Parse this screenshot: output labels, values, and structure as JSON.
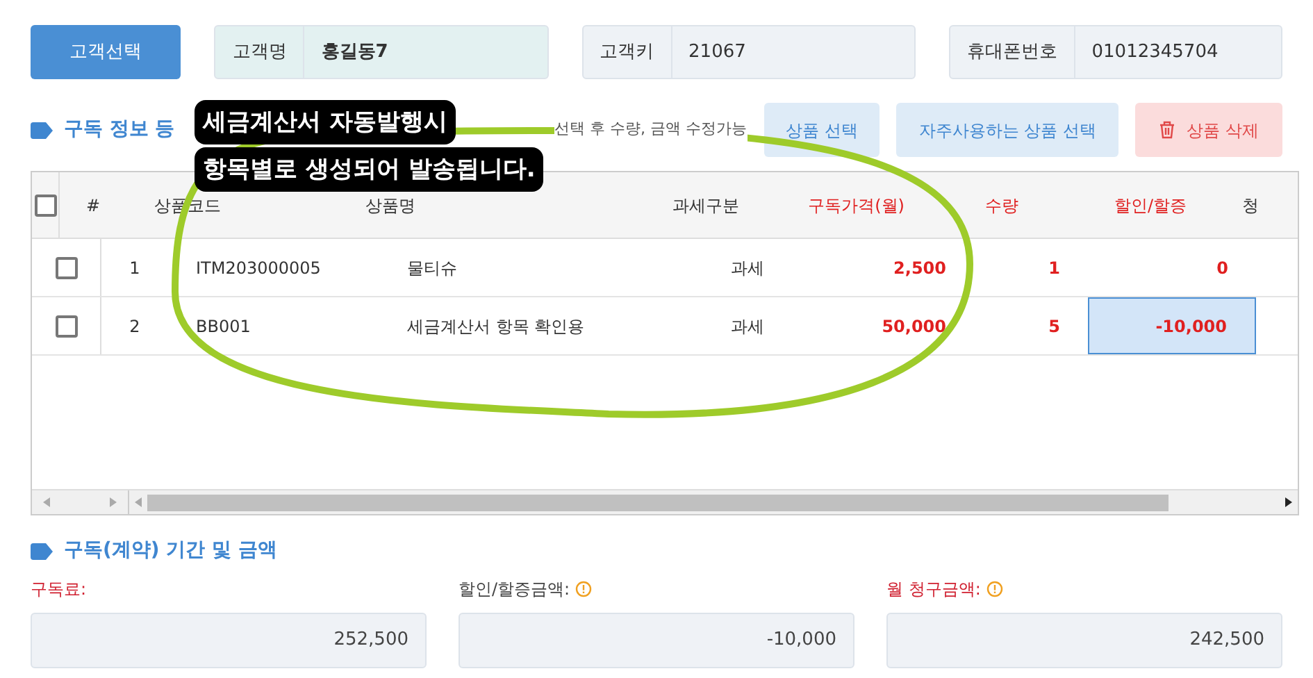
{
  "customer_button": "고객선택",
  "customer_fields": [
    {
      "label": "고객명",
      "value": "홍길동7",
      "highlight": true
    },
    {
      "label": "고객키",
      "value": "21067",
      "highlight": false
    },
    {
      "label": "휴대폰번호",
      "value": "01012345704",
      "highlight": false
    }
  ],
  "subscription_section": {
    "title": "구독 정보 등",
    "hint": "선택 후 수량, 금액 수정가능",
    "buttons": [
      {
        "label": "상품 선택",
        "kind": "normal"
      },
      {
        "label": "자주사용하는 상품 선택",
        "kind": "normal"
      },
      {
        "label": "상품 삭제",
        "kind": "danger"
      }
    ]
  },
  "annotation": {
    "lines": [
      "세금계산서 자동발행시",
      "항목별로 생성되어 발송됩니다."
    ]
  },
  "table": {
    "header_checkbox": {
      "checked": false
    },
    "columns": [
      {
        "label": "#",
        "required": false
      },
      {
        "label": "상품코드",
        "required": false
      },
      {
        "label": "상품명",
        "required": false
      },
      {
        "label": "과세구분",
        "required": false
      },
      {
        "label": "구독가격(월)",
        "required": true
      },
      {
        "label": "수량",
        "required": true
      },
      {
        "label": "할인/할증",
        "required": true
      },
      {
        "label": "청",
        "required": false
      }
    ],
    "rows": [
      {
        "checked": false,
        "cells": [
          {
            "text": "1",
            "selected": false
          },
          {
            "text": "ITM203000005",
            "selected": false
          },
          {
            "text": "물티슈",
            "selected": false
          },
          {
            "text": "과세",
            "selected": false
          },
          {
            "text": "2,500",
            "selected": false
          },
          {
            "text": "1",
            "selected": false
          },
          {
            "text": "0",
            "selected": false
          }
        ]
      },
      {
        "checked": false,
        "cells": [
          {
            "text": "2",
            "selected": false
          },
          {
            "text": "BB001",
            "selected": false
          },
          {
            "text": "세금계산서 항목 확인용",
            "selected": false
          },
          {
            "text": "과세",
            "selected": false
          },
          {
            "text": "50,000",
            "selected": false
          },
          {
            "text": "5",
            "selected": false
          },
          {
            "text": "-10,000",
            "selected": true
          }
        ]
      }
    ]
  },
  "amount_section": {
    "title": "구독(계약) 기간 및 금액",
    "fields": [
      {
        "label": "구독료:",
        "required": true,
        "info": false,
        "value": "252,500"
      },
      {
        "label": "할인/할증금액:",
        "required": false,
        "info": true,
        "value": "-10,000"
      },
      {
        "label": "월 청구금액:",
        "required": true,
        "info": true,
        "value": "242,500"
      }
    ]
  }
}
